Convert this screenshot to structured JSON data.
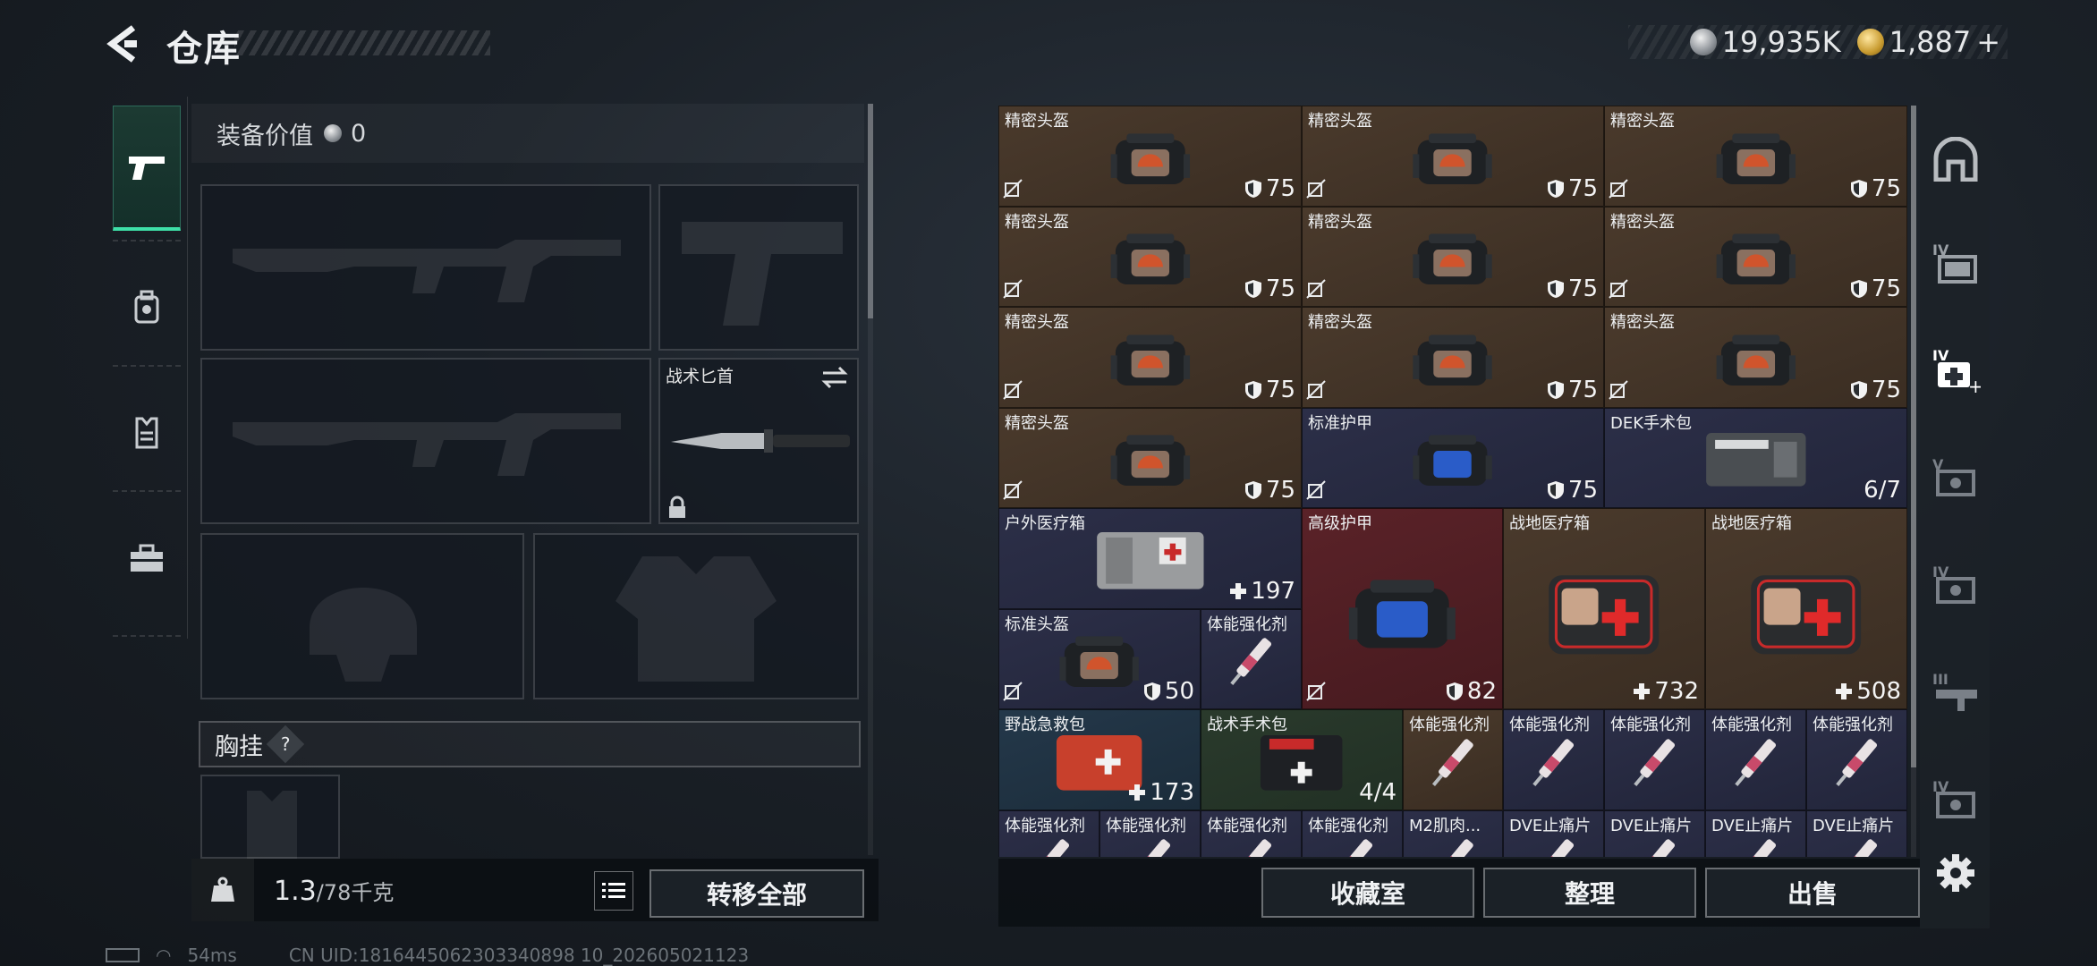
{
  "header": {
    "title": "仓库",
    "currency": [
      {
        "icon": "silver-coin-icon",
        "amount": "19,935K"
      },
      {
        "icon": "gold-coin-icon",
        "amount": "1,887"
      }
    ],
    "add_symbol": "+"
  },
  "tabs": [
    {
      "icon": "pistol-icon",
      "active": true
    },
    {
      "icon": "backpack-icon",
      "active": false
    },
    {
      "icon": "vest-icon",
      "active": false
    },
    {
      "icon": "toolbox-icon",
      "active": false
    }
  ],
  "loadout": {
    "value_label": "装备价值",
    "value_amount": "0",
    "knife_label": "战术匕首",
    "chest_label": "胸挂",
    "chest_help": "?"
  },
  "footer": {
    "weight_current": "1.3",
    "weight_max": "/78千克",
    "transfer_all": "转移全部",
    "collection": "收藏室",
    "organize": "整理",
    "sell": "出售"
  },
  "inventory": [
    {
      "name": "精密头盔",
      "value": "75",
      "kind": "shield",
      "bg": "brown",
      "item": "helmet"
    },
    {
      "name": "精密头盔",
      "value": "75",
      "kind": "shield",
      "bg": "brown",
      "item": "helmet"
    },
    {
      "name": "精密头盔",
      "value": "75",
      "kind": "shield",
      "bg": "brown",
      "item": "helmet"
    },
    {
      "name": "精密头盔",
      "value": "75",
      "kind": "shield",
      "bg": "brown",
      "item": "helmet"
    },
    {
      "name": "精密头盔",
      "value": "75",
      "kind": "shield",
      "bg": "brown",
      "item": "helmet"
    },
    {
      "name": "精密头盔",
      "value": "75",
      "kind": "shield",
      "bg": "brown",
      "item": "helmet"
    },
    {
      "name": "精密头盔",
      "value": "75",
      "kind": "shield",
      "bg": "brown",
      "item": "helmet"
    },
    {
      "name": "精密头盔",
      "value": "75",
      "kind": "shield",
      "bg": "brown",
      "item": "helmet"
    },
    {
      "name": "精密头盔",
      "value": "75",
      "kind": "shield",
      "bg": "brown",
      "item": "helmet"
    },
    {
      "name": "精密头盔",
      "value": "75",
      "kind": "shield",
      "bg": "brown",
      "item": "helmet"
    },
    {
      "name": "标准护甲",
      "value": "75",
      "kind": "shield",
      "bg": "navy",
      "item": "armor"
    },
    {
      "name": "DEK手术包",
      "value": "6/7",
      "kind": "count",
      "bg": "navy",
      "item": "kit"
    },
    {
      "name": "户外医疗箱",
      "value": "197",
      "kind": "plus",
      "bg": "navy",
      "item": "outdoor"
    },
    {
      "name": "高级护甲",
      "value": "82",
      "kind": "shield",
      "bg": "red",
      "item": "armor"
    },
    {
      "name": "战地医疗箱",
      "value": "732",
      "kind": "plus",
      "bg": "brown",
      "item": "firstaid"
    },
    {
      "name": "战地医疗箱",
      "value": "508",
      "kind": "plus",
      "bg": "brown",
      "item": "firstaid"
    },
    {
      "name": "标准头盔",
      "value": "50",
      "kind": "shield",
      "bg": "navy",
      "item": "helmet"
    },
    {
      "name": "体能强化剂",
      "value": "",
      "kind": "none",
      "bg": "navy",
      "item": "syringe"
    },
    {
      "name": "野战急救包",
      "value": "173",
      "kind": "plus",
      "bg": "teal",
      "item": "redkit"
    },
    {
      "name": "战术手术包",
      "value": "4/4",
      "kind": "count",
      "bg": "green",
      "item": "darkkit"
    },
    {
      "name": "体能强化剂",
      "value": "",
      "kind": "none",
      "bg": "brown",
      "item": "syringe"
    },
    {
      "name": "体能强化剂",
      "value": "",
      "kind": "none",
      "bg": "navy",
      "item": "syringe"
    },
    {
      "name": "体能强化剂",
      "value": "",
      "kind": "none",
      "bg": "navy",
      "item": "syringe"
    },
    {
      "name": "体能强化剂",
      "value": "",
      "kind": "none",
      "bg": "navy",
      "item": "syringe"
    },
    {
      "name": "体能强化剂",
      "value": "",
      "kind": "none",
      "bg": "navy",
      "item": "syringe"
    },
    {
      "name": "体能强化剂",
      "value": "",
      "kind": "none",
      "bg": "navy",
      "item": "syringe"
    },
    {
      "name": "体能强化剂",
      "value": "",
      "kind": "none",
      "bg": "navy",
      "item": "syringe"
    },
    {
      "name": "体能强化剂",
      "value": "",
      "kind": "none",
      "bg": "navy",
      "item": "syringe"
    },
    {
      "name": "体能强化剂",
      "value": "",
      "kind": "none",
      "bg": "navy",
      "item": "syringe"
    },
    {
      "name": "M2肌肉...",
      "value": "",
      "kind": "none",
      "bg": "navy",
      "item": "syringe"
    },
    {
      "name": "DVE止痛片",
      "value": "",
      "kind": "none",
      "bg": "navy",
      "item": "syringe"
    },
    {
      "name": "DVE止痛片",
      "value": "",
      "kind": "none",
      "bg": "navy",
      "item": "syringe"
    },
    {
      "name": "DVE止痛片",
      "value": "",
      "kind": "none",
      "bg": "navy",
      "item": "syringe"
    },
    {
      "name": "DVE止痛片",
      "value": "",
      "kind": "none",
      "bg": "navy",
      "item": "syringe"
    }
  ],
  "right_sidebar": [
    {
      "icon": "safe-room-icon"
    },
    {
      "icon": "tier4-container-icon",
      "tier": "IV"
    },
    {
      "icon": "tier4-medkit-icon",
      "tier": "IV"
    },
    {
      "icon": "tier5-armor-icon",
      "tier": "V"
    },
    {
      "icon": "tier4-armor-icon",
      "tier": "IV"
    },
    {
      "icon": "tier3-weapon-icon",
      "tier": "III"
    },
    {
      "icon": "tier4-gear-icon",
      "tier": "IV"
    },
    {
      "icon": "settings-gear-icon"
    }
  ],
  "status": {
    "ping": "54ms",
    "uid": "CN UID:1816445062303340898 10_202605021123"
  },
  "colors": {
    "accent_green": "#3ee0a8",
    "cell_brown": "#4a3a2c",
    "cell_navy": "#2c2f48",
    "cell_red": "#5a2228"
  }
}
